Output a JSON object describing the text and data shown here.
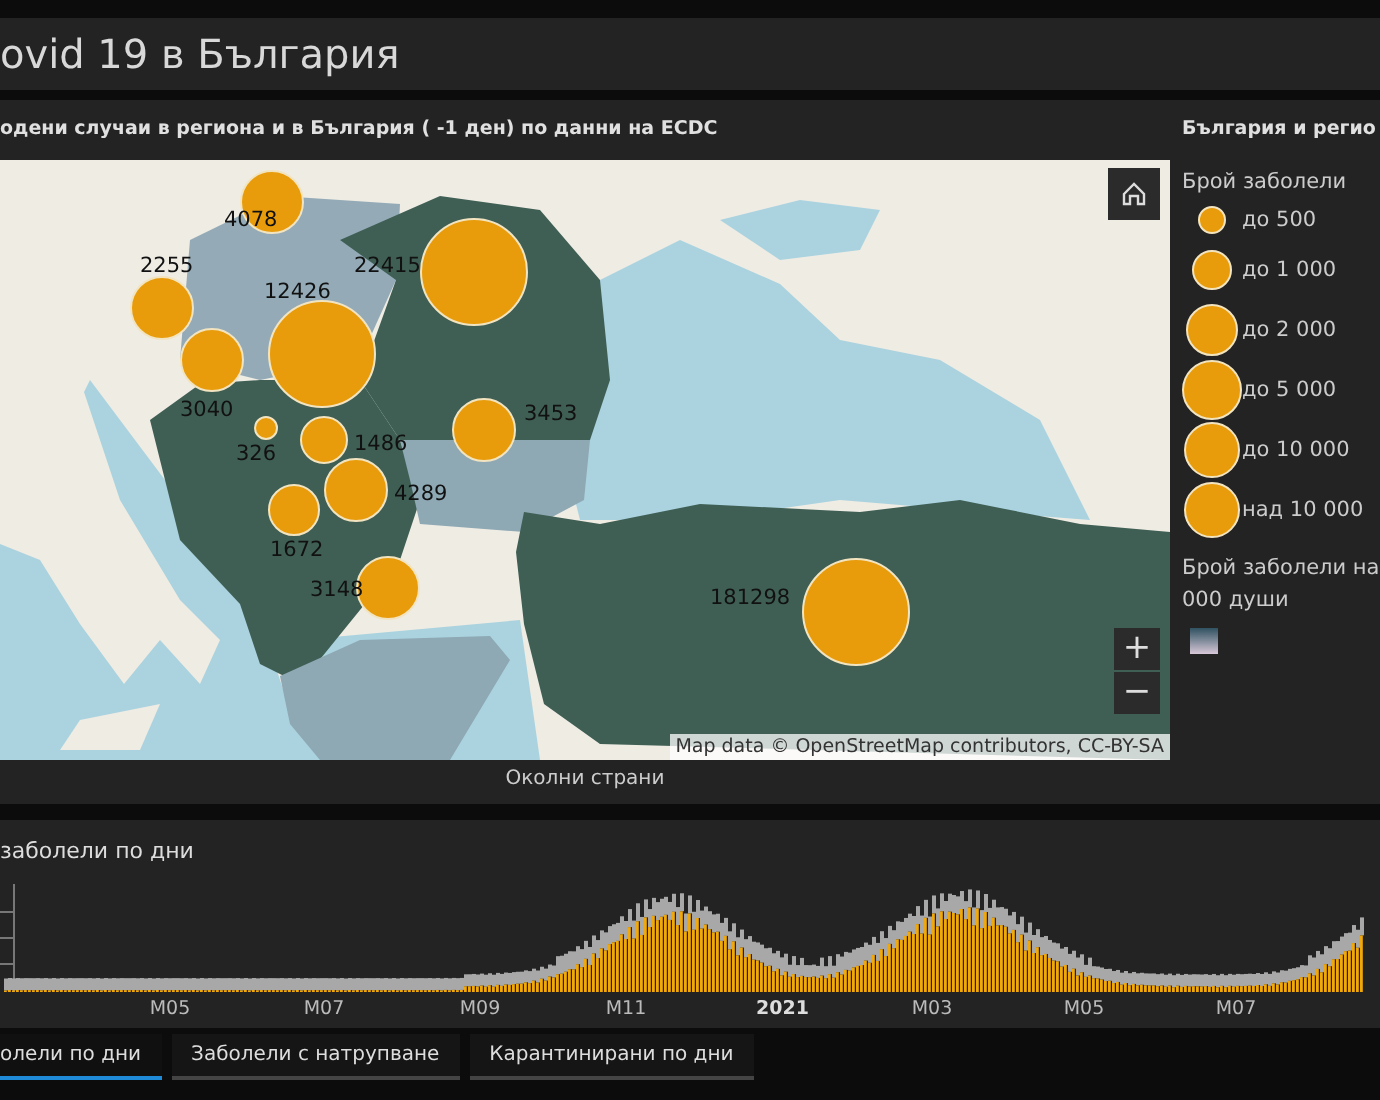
{
  "header": {
    "title": "ovid 19 в България"
  },
  "map_panel": {
    "title": "одени случаи в региона и в България ( -1 ден) по данни на ECDC",
    "bubbles": [
      {
        "label": "4078"
      },
      {
        "label": "22415"
      },
      {
        "label": "2255"
      },
      {
        "label": "12426"
      },
      {
        "label": "3040"
      },
      {
        "label": "326"
      },
      {
        "label": "1486"
      },
      {
        "label": "4289"
      },
      {
        "label": "1672"
      },
      {
        "label": "3453"
      },
      {
        "label": "3148"
      },
      {
        "label": "181298"
      }
    ],
    "zoom_in": "+",
    "zoom_out": "−",
    "attribution": "Map data © OpenStreetMap contributors, CC-BY-SA",
    "caption": "Околни страни"
  },
  "legend": {
    "title": "България и регио",
    "size_title": "Брой заболели",
    "size_items": [
      {
        "label": "до 500"
      },
      {
        "label": "до 1 000"
      },
      {
        "label": "до 2 000"
      },
      {
        "label": "до 5 000"
      },
      {
        "label": "до 10 000"
      },
      {
        "label": "над 10 000"
      }
    ],
    "color_title": [
      "Брой заболели на",
      "000 души"
    ]
  },
  "chart_panel": {
    "title": "заболели по дни",
    "x_labels": [
      "M05",
      "M07",
      "M09",
      "M11",
      "2021",
      "M03",
      "M05",
      "M07"
    ]
  },
  "tabs": [
    {
      "label": "олели по дни",
      "selected": true
    },
    {
      "label": "Заболели с натрупване",
      "selected": false
    },
    {
      "label": "Карантинирани по дни",
      "selected": false
    }
  ]
}
